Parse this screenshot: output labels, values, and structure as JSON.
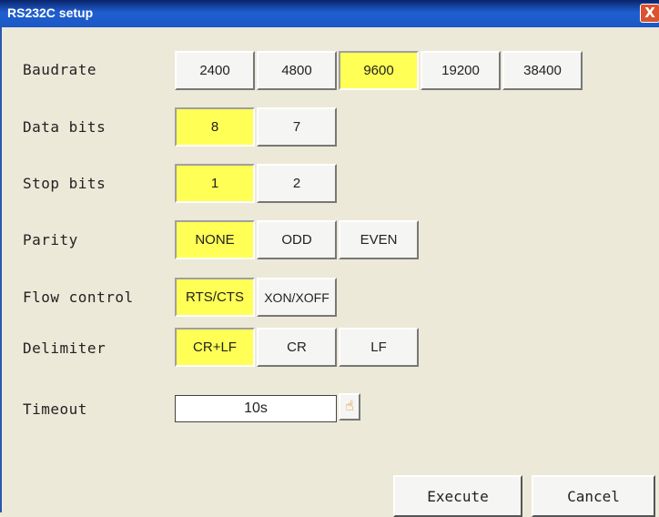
{
  "window": {
    "title": "RS232C setup",
    "close_label": "X"
  },
  "rows": {
    "baudrate": {
      "label": "Baudrate",
      "options": [
        "2400",
        "4800",
        "9600",
        "19200",
        "38400"
      ],
      "selected": "9600"
    },
    "data_bits": {
      "label": "Data bits",
      "options": [
        "8",
        "7"
      ],
      "selected": "8"
    },
    "stop_bits": {
      "label": "Stop bits",
      "options": [
        "1",
        "2"
      ],
      "selected": "1"
    },
    "parity": {
      "label": "Parity",
      "options": [
        "NONE",
        "ODD",
        "EVEN"
      ],
      "selected": "NONE"
    },
    "flow_control": {
      "label": "Flow control",
      "options": [
        "RTS/CTS",
        "XON/XOFF"
      ],
      "selected": "RTS/CTS"
    },
    "delimiter": {
      "label": "Delimiter",
      "options": [
        "CR+LF",
        "CR",
        "LF"
      ],
      "selected": "CR+LF"
    }
  },
  "timeout": {
    "label": "Timeout",
    "value": "10s",
    "icon": "hand-pointer-icon"
  },
  "actions": {
    "execute_label": "Execute",
    "cancel_label": "Cancel"
  },
  "colors": {
    "selected": "#ffff55",
    "titlebar": "#1f5fd0",
    "background": "#ece9d8"
  }
}
